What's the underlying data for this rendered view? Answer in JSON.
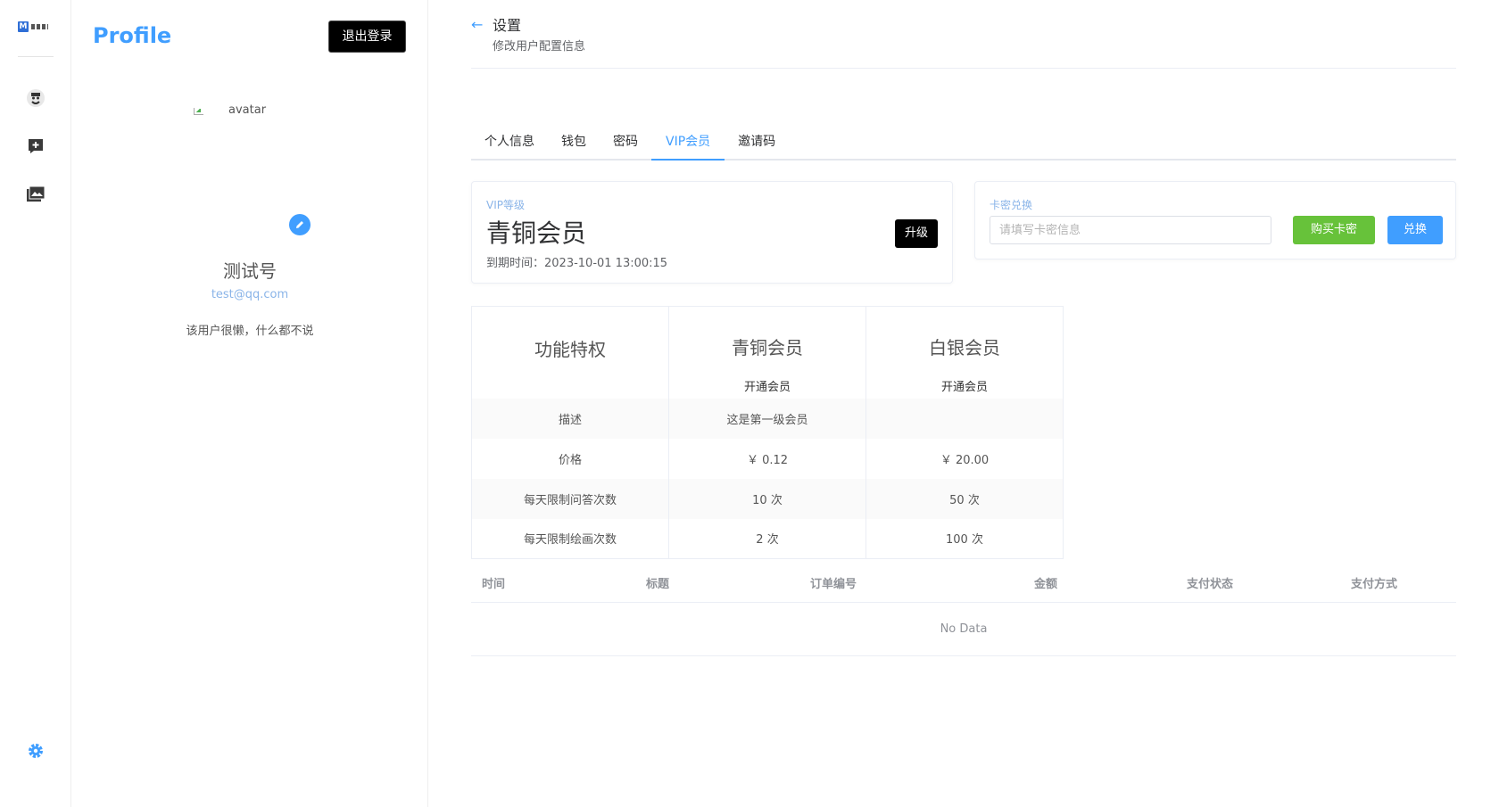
{
  "sidebar_icons": [
    "logo-icon",
    "avatar-robot-icon",
    "chat-add-icon",
    "image-gallery-icon",
    "settings-gear-icon"
  ],
  "profile": {
    "title": "Profile",
    "logout_label": "退出登录",
    "avatar_alt": "avatar",
    "username": "测试号",
    "email": "test@qq.com",
    "bio": "该用户很懒，什么都不说"
  },
  "header": {
    "back_arrow": "←",
    "title": "设置",
    "subtitle": "修改用户配置信息"
  },
  "tabs": [
    {
      "label": "个人信息",
      "active": false
    },
    {
      "label": "钱包",
      "active": false
    },
    {
      "label": "密码",
      "active": false
    },
    {
      "label": "VIP会员",
      "active": true
    },
    {
      "label": "邀请码",
      "active": false
    }
  ],
  "vip_card": {
    "label": "VIP等级",
    "level": "青铜会员",
    "expire": "到期时间：2023-10-01 13:00:15",
    "upgrade_label": "升级"
  },
  "redeem_card": {
    "label": "卡密兑换",
    "placeholder": "请填写卡密信息",
    "buy_label": "购买卡密",
    "exchange_label": "兑换"
  },
  "privilege_table": {
    "header": [
      "功能特权",
      "青铜会员",
      "白银会员"
    ],
    "open_label": "开通会员",
    "rows": [
      [
        "描述",
        "这是第一级会员",
        ""
      ],
      [
        "价格",
        "￥ 0.12",
        "￥ 20.00"
      ],
      [
        "每天限制问答次数",
        "10 次",
        "50 次"
      ],
      [
        "每天限制绘画次数",
        "2 次",
        "100 次"
      ]
    ]
  },
  "order_table": {
    "columns": [
      "时间",
      "标题",
      "订单编号",
      "金额",
      "支付状态",
      "支付方式"
    ],
    "empty_text": "No Data"
  },
  "colors": {
    "primary": "#409eff",
    "success": "#67c23a",
    "dark_button": "#000000"
  }
}
